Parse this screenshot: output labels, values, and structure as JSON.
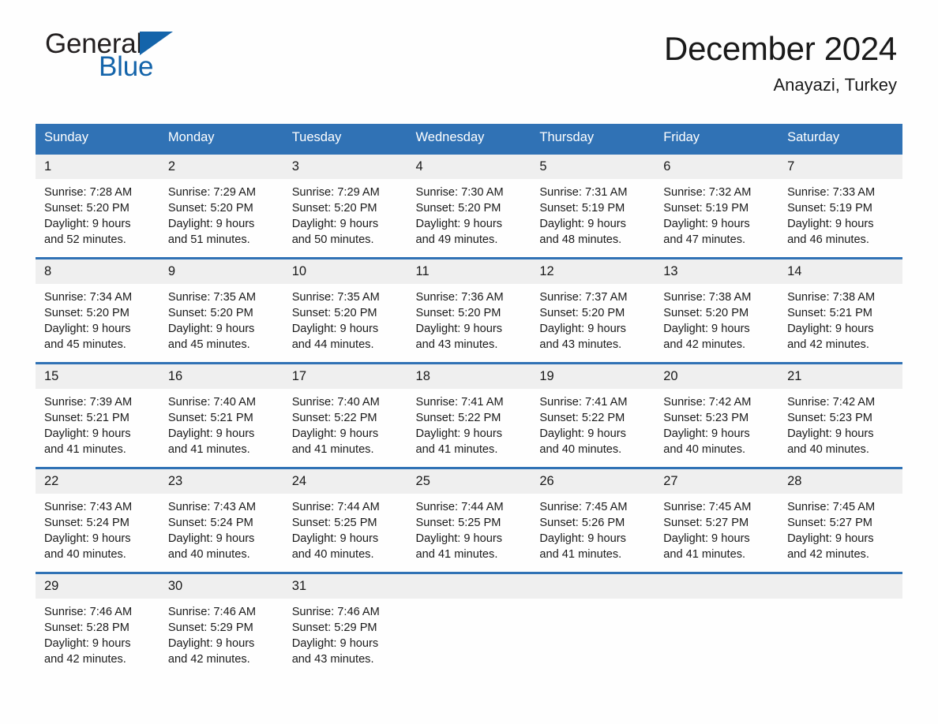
{
  "brand": {
    "name_part1": "General",
    "name_part2": "Blue",
    "logo_icon": "triangle-flag-icon"
  },
  "header": {
    "month_title": "December 2024",
    "location": "Anayazi, Turkey"
  },
  "colors": {
    "header_blue": "#3072b5",
    "brand_blue": "#1464aa",
    "daynum_band": "#efefef",
    "page_background": "#fefefe",
    "text": "#1a1a1a"
  },
  "calendar": {
    "weekday_headers": [
      "Sunday",
      "Monday",
      "Tuesday",
      "Wednesday",
      "Thursday",
      "Friday",
      "Saturday"
    ],
    "weeks": [
      [
        {
          "day": "1",
          "sunrise": "Sunrise: 7:28 AM",
          "sunset": "Sunset: 5:20 PM",
          "daylight_line1": "Daylight: 9 hours",
          "daylight_line2": "and 52 minutes."
        },
        {
          "day": "2",
          "sunrise": "Sunrise: 7:29 AM",
          "sunset": "Sunset: 5:20 PM",
          "daylight_line1": "Daylight: 9 hours",
          "daylight_line2": "and 51 minutes."
        },
        {
          "day": "3",
          "sunrise": "Sunrise: 7:29 AM",
          "sunset": "Sunset: 5:20 PM",
          "daylight_line1": "Daylight: 9 hours",
          "daylight_line2": "and 50 minutes."
        },
        {
          "day": "4",
          "sunrise": "Sunrise: 7:30 AM",
          "sunset": "Sunset: 5:20 PM",
          "daylight_line1": "Daylight: 9 hours",
          "daylight_line2": "and 49 minutes."
        },
        {
          "day": "5",
          "sunrise": "Sunrise: 7:31 AM",
          "sunset": "Sunset: 5:19 PM",
          "daylight_line1": "Daylight: 9 hours",
          "daylight_line2": "and 48 minutes."
        },
        {
          "day": "6",
          "sunrise": "Sunrise: 7:32 AM",
          "sunset": "Sunset: 5:19 PM",
          "daylight_line1": "Daylight: 9 hours",
          "daylight_line2": "and 47 minutes."
        },
        {
          "day": "7",
          "sunrise": "Sunrise: 7:33 AM",
          "sunset": "Sunset: 5:19 PM",
          "daylight_line1": "Daylight: 9 hours",
          "daylight_line2": "and 46 minutes."
        }
      ],
      [
        {
          "day": "8",
          "sunrise": "Sunrise: 7:34 AM",
          "sunset": "Sunset: 5:20 PM",
          "daylight_line1": "Daylight: 9 hours",
          "daylight_line2": "and 45 minutes."
        },
        {
          "day": "9",
          "sunrise": "Sunrise: 7:35 AM",
          "sunset": "Sunset: 5:20 PM",
          "daylight_line1": "Daylight: 9 hours",
          "daylight_line2": "and 45 minutes."
        },
        {
          "day": "10",
          "sunrise": "Sunrise: 7:35 AM",
          "sunset": "Sunset: 5:20 PM",
          "daylight_line1": "Daylight: 9 hours",
          "daylight_line2": "and 44 minutes."
        },
        {
          "day": "11",
          "sunrise": "Sunrise: 7:36 AM",
          "sunset": "Sunset: 5:20 PM",
          "daylight_line1": "Daylight: 9 hours",
          "daylight_line2": "and 43 minutes."
        },
        {
          "day": "12",
          "sunrise": "Sunrise: 7:37 AM",
          "sunset": "Sunset: 5:20 PM",
          "daylight_line1": "Daylight: 9 hours",
          "daylight_line2": "and 43 minutes."
        },
        {
          "day": "13",
          "sunrise": "Sunrise: 7:38 AM",
          "sunset": "Sunset: 5:20 PM",
          "daylight_line1": "Daylight: 9 hours",
          "daylight_line2": "and 42 minutes."
        },
        {
          "day": "14",
          "sunrise": "Sunrise: 7:38 AM",
          "sunset": "Sunset: 5:21 PM",
          "daylight_line1": "Daylight: 9 hours",
          "daylight_line2": "and 42 minutes."
        }
      ],
      [
        {
          "day": "15",
          "sunrise": "Sunrise: 7:39 AM",
          "sunset": "Sunset: 5:21 PM",
          "daylight_line1": "Daylight: 9 hours",
          "daylight_line2": "and 41 minutes."
        },
        {
          "day": "16",
          "sunrise": "Sunrise: 7:40 AM",
          "sunset": "Sunset: 5:21 PM",
          "daylight_line1": "Daylight: 9 hours",
          "daylight_line2": "and 41 minutes."
        },
        {
          "day": "17",
          "sunrise": "Sunrise: 7:40 AM",
          "sunset": "Sunset: 5:22 PM",
          "daylight_line1": "Daylight: 9 hours",
          "daylight_line2": "and 41 minutes."
        },
        {
          "day": "18",
          "sunrise": "Sunrise: 7:41 AM",
          "sunset": "Sunset: 5:22 PM",
          "daylight_line1": "Daylight: 9 hours",
          "daylight_line2": "and 41 minutes."
        },
        {
          "day": "19",
          "sunrise": "Sunrise: 7:41 AM",
          "sunset": "Sunset: 5:22 PM",
          "daylight_line1": "Daylight: 9 hours",
          "daylight_line2": "and 40 minutes."
        },
        {
          "day": "20",
          "sunrise": "Sunrise: 7:42 AM",
          "sunset": "Sunset: 5:23 PM",
          "daylight_line1": "Daylight: 9 hours",
          "daylight_line2": "and 40 minutes."
        },
        {
          "day": "21",
          "sunrise": "Sunrise: 7:42 AM",
          "sunset": "Sunset: 5:23 PM",
          "daylight_line1": "Daylight: 9 hours",
          "daylight_line2": "and 40 minutes."
        }
      ],
      [
        {
          "day": "22",
          "sunrise": "Sunrise: 7:43 AM",
          "sunset": "Sunset: 5:24 PM",
          "daylight_line1": "Daylight: 9 hours",
          "daylight_line2": "and 40 minutes."
        },
        {
          "day": "23",
          "sunrise": "Sunrise: 7:43 AM",
          "sunset": "Sunset: 5:24 PM",
          "daylight_line1": "Daylight: 9 hours",
          "daylight_line2": "and 40 minutes."
        },
        {
          "day": "24",
          "sunrise": "Sunrise: 7:44 AM",
          "sunset": "Sunset: 5:25 PM",
          "daylight_line1": "Daylight: 9 hours",
          "daylight_line2": "and 40 minutes."
        },
        {
          "day": "25",
          "sunrise": "Sunrise: 7:44 AM",
          "sunset": "Sunset: 5:25 PM",
          "daylight_line1": "Daylight: 9 hours",
          "daylight_line2": "and 41 minutes."
        },
        {
          "day": "26",
          "sunrise": "Sunrise: 7:45 AM",
          "sunset": "Sunset: 5:26 PM",
          "daylight_line1": "Daylight: 9 hours",
          "daylight_line2": "and 41 minutes."
        },
        {
          "day": "27",
          "sunrise": "Sunrise: 7:45 AM",
          "sunset": "Sunset: 5:27 PM",
          "daylight_line1": "Daylight: 9 hours",
          "daylight_line2": "and 41 minutes."
        },
        {
          "day": "28",
          "sunrise": "Sunrise: 7:45 AM",
          "sunset": "Sunset: 5:27 PM",
          "daylight_line1": "Daylight: 9 hours",
          "daylight_line2": "and 42 minutes."
        }
      ],
      [
        {
          "day": "29",
          "sunrise": "Sunrise: 7:46 AM",
          "sunset": "Sunset: 5:28 PM",
          "daylight_line1": "Daylight: 9 hours",
          "daylight_line2": "and 42 minutes."
        },
        {
          "day": "30",
          "sunrise": "Sunrise: 7:46 AM",
          "sunset": "Sunset: 5:29 PM",
          "daylight_line1": "Daylight: 9 hours",
          "daylight_line2": "and 42 minutes."
        },
        {
          "day": "31",
          "sunrise": "Sunrise: 7:46 AM",
          "sunset": "Sunset: 5:29 PM",
          "daylight_line1": "Daylight: 9 hours",
          "daylight_line2": "and 43 minutes."
        },
        {
          "day": "",
          "sunrise": "",
          "sunset": "",
          "daylight_line1": "",
          "daylight_line2": ""
        },
        {
          "day": "",
          "sunrise": "",
          "sunset": "",
          "daylight_line1": "",
          "daylight_line2": ""
        },
        {
          "day": "",
          "sunrise": "",
          "sunset": "",
          "daylight_line1": "",
          "daylight_line2": ""
        },
        {
          "day": "",
          "sunrise": "",
          "sunset": "",
          "daylight_line1": "",
          "daylight_line2": ""
        }
      ]
    ]
  }
}
